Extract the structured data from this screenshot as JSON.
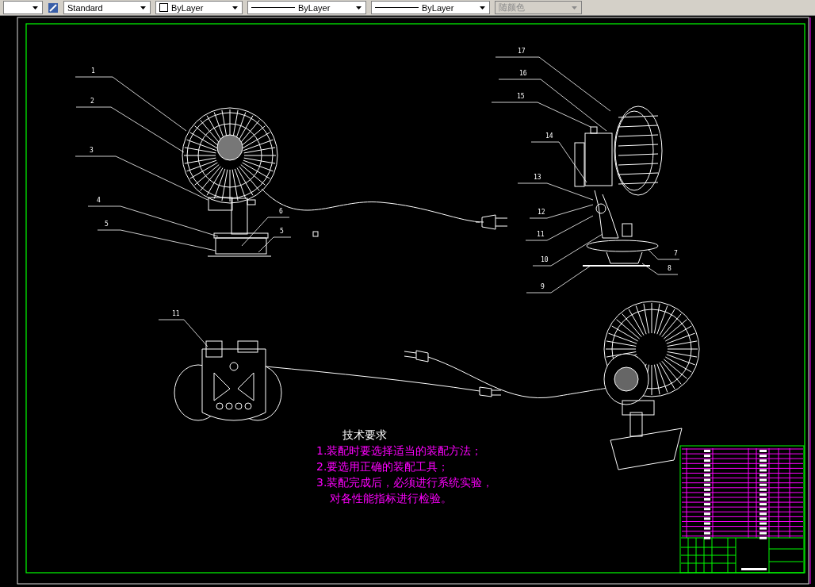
{
  "toolbar": {
    "dropdowns": [
      {
        "kind": "plain",
        "label": "Standard",
        "disabled": false
      },
      {
        "kind": "color",
        "label": "ByLayer",
        "disabled": false
      },
      {
        "kind": "line",
        "label": "ByLayer",
        "disabled": false
      },
      {
        "kind": "line",
        "label": "ByLayer",
        "disabled": false
      },
      {
        "kind": "plain",
        "label": "随颜色",
        "disabled": true
      }
    ]
  },
  "drawing": {
    "balloons": [
      "1",
      "2",
      "3",
      "4",
      "5",
      "6",
      "5",
      "17",
      "16",
      "15",
      "14",
      "13",
      "12",
      "11",
      "10",
      "9",
      "7",
      "8",
      "11"
    ],
    "technical_requirements": {
      "title": "技术要求",
      "lines": [
        "1.装配时要选择适当的装配方法；",
        "2.要选用正确的装配工具；",
        "3.装配完成后，必须进行系统实验，",
        "对各性能指标进行检验。"
      ]
    }
  }
}
